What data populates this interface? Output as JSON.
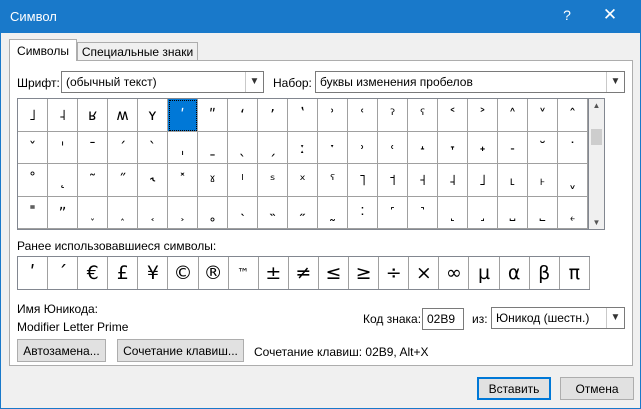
{
  "window": {
    "title": "Символ",
    "help": "?",
    "close": "✕"
  },
  "tabs": [
    {
      "label": "Символы"
    },
    {
      "label": "Специальные знаки"
    }
  ],
  "font": {
    "label": "Шрифт:",
    "value": "(обычный текст)"
  },
  "subset": {
    "label": "Набор:",
    "value": "буквы изменения пробелов"
  },
  "symbol_grid": [
    [
      "˩",
      "˨",
      "ʁ",
      "ʍ",
      "ʏ",
      "ʹ",
      "ʺ",
      "ʻ",
      "ʼ",
      "ʽ",
      "ʾ",
      "ʿ",
      "ˀ",
      "ˁ",
      "˂",
      "˃",
      "˄",
      "˅",
      "ˆ"
    ],
    [
      "ˇ",
      "ˈ",
      "ˉ",
      "ˊ",
      "ˋ",
      "ˌ",
      "ˍ",
      "ˎ",
      "ˏ",
      "ː",
      "ˑ",
      "˒",
      "˓",
      "˔",
      "˕",
      "˖",
      "˗",
      "˘",
      "˙"
    ],
    [
      "˚",
      "˛",
      "˜",
      "˝",
      "˞",
      "˟",
      "ˠ",
      "ˡ",
      "ˢ",
      "ˣ",
      "ˤ",
      "˥",
      "˦",
      "˧",
      "˨",
      "˩",
      "˪",
      "˫",
      "ˬ"
    ],
    [
      "˭",
      "ˮ",
      "˯",
      "˰",
      "˱",
      "˲",
      "˳",
      "˴",
      "˵",
      "˶",
      "˷",
      "˸",
      "˹",
      "˺",
      "˻",
      "˼",
      "˽",
      "˾",
      "˿"
    ]
  ],
  "selected_symbol": {
    "row": 0,
    "col": 5
  },
  "recent": {
    "label": "Ранее использовавшиеся символы:",
    "symbols": [
      "ʹ",
      "ˊ",
      "€",
      "£",
      "¥",
      "©",
      "®",
      "™",
      "±",
      "≠",
      "≤",
      "≥",
      "÷",
      "×",
      "∞",
      "µ",
      "α",
      "β",
      "π"
    ]
  },
  "unicode_name": {
    "label": "Имя Юникода:",
    "value": "Modifier Letter Prime"
  },
  "char_code": {
    "label": "Код знака:",
    "value": "02B9"
  },
  "from": {
    "label": "из:",
    "value": "Юникод (шестн.)"
  },
  "buttons": {
    "autocorrect": "Автозамена...",
    "shortcut_key": "Сочетание клавиш...",
    "insert": "Вставить",
    "cancel": "Отмена"
  },
  "shortcut_text": "Сочетание клавиш: 02B9, Alt+X",
  "colors": {
    "accent": "#1979ca",
    "selection": "#0078d7"
  },
  "icons": {
    "close": "close-icon",
    "help": "help-icon",
    "dropdown": "chevron-down-icon"
  }
}
